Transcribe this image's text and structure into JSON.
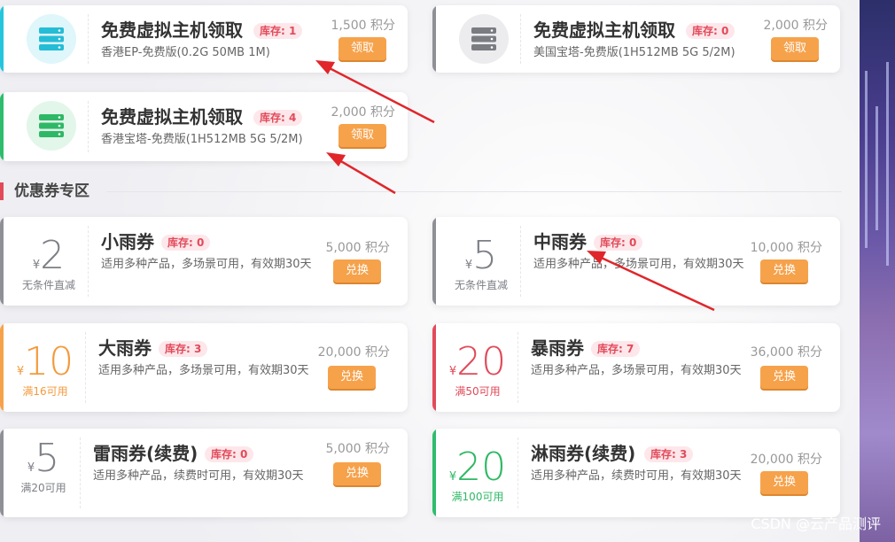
{
  "vps_cards": [
    {
      "title": "免费虚拟主机领取",
      "stock": "库存: 1",
      "subtitle": "香港EP-免费版(0.2G 50MB 1M)",
      "points": "1,500 积分",
      "button": "领取",
      "accent": "#24c6dc",
      "icon_bg": "#dff6fa",
      "icon_color": "#25bcd6",
      "icon": "server-icon"
    },
    {
      "title": "免费虚拟主机领取",
      "stock": "库存: 0",
      "subtitle": "美国宝塔-免费版(1H512MB 5G 5/2M)",
      "points": "2,000 积分",
      "button": "领取",
      "accent": "#8e9096",
      "icon_bg": "#ececee",
      "icon_color": "#7a7c82",
      "icon": "server-icon"
    },
    {
      "title": "免费虚拟主机领取",
      "stock": "库存: 4",
      "subtitle": "香港宝塔-免费版(1H512MB 5G 5/2M)",
      "points": "2,000 积分",
      "button": "领取",
      "accent": "#2ebd6c",
      "icon_bg": "#e2f6ea",
      "icon_color": "#2eb866",
      "icon": "server-icon"
    }
  ],
  "section": {
    "title": "优惠券专区"
  },
  "coupons": [
    {
      "currency": "¥",
      "amount": "2",
      "condition": "无条件直减",
      "title": "小雨券",
      "stock": "库存: 0",
      "desc": "适用多种产品，多场景可用，有效期30天",
      "points": "5,000 积分",
      "button": "兑换",
      "accent": "#8e9096",
      "color": "#7d7f86"
    },
    {
      "currency": "¥",
      "amount": "5",
      "condition": "无条件直减",
      "title": "中雨券",
      "stock": "库存: 0",
      "desc": "适用多种产品，多场景可用，有效期30天",
      "points": "10,000 积分",
      "button": "兑换",
      "accent": "#8e9096",
      "color": "#7d7f86"
    },
    {
      "currency": "¥",
      "amount": "10",
      "condition": "满16可用",
      "title": "大雨券",
      "stock": "库存: 3",
      "desc": "适用多种产品，多场景可用，有效期30天",
      "points": "20,000 积分",
      "button": "兑换",
      "accent": "#f6a24b",
      "color": "#f39a3d"
    },
    {
      "currency": "¥",
      "amount": "20",
      "condition": "满50可用",
      "title": "暴雨券",
      "stock": "库存: 7",
      "desc": "适用多种产品，多场景可用，有效期30天",
      "points": "36,000 积分",
      "button": "兑换",
      "accent": "#e24a5a",
      "color": "#e04a58"
    },
    {
      "currency": "¥",
      "amount": "5",
      "condition": "满20可用",
      "title": "雷雨券(续费)",
      "stock": "库存: 0",
      "desc": "适用多种产品，续费时可用，有效期30天",
      "points": "5,000 积分",
      "button": "兑换",
      "accent": "#8e9096",
      "color": "#7d7f86"
    },
    {
      "currency": "¥",
      "amount": "20",
      "condition": "满100可用",
      "title": "淋雨券(续费)",
      "stock": "库存: 3",
      "desc": "适用多种产品，续费时可用，有效期30天",
      "points": "20,000 积分",
      "button": "兑换",
      "accent": "#2ebd6c",
      "color": "#2fb865"
    }
  ],
  "watermark": "CSDN @云产品测评",
  "annotation_color": "#e0262b"
}
